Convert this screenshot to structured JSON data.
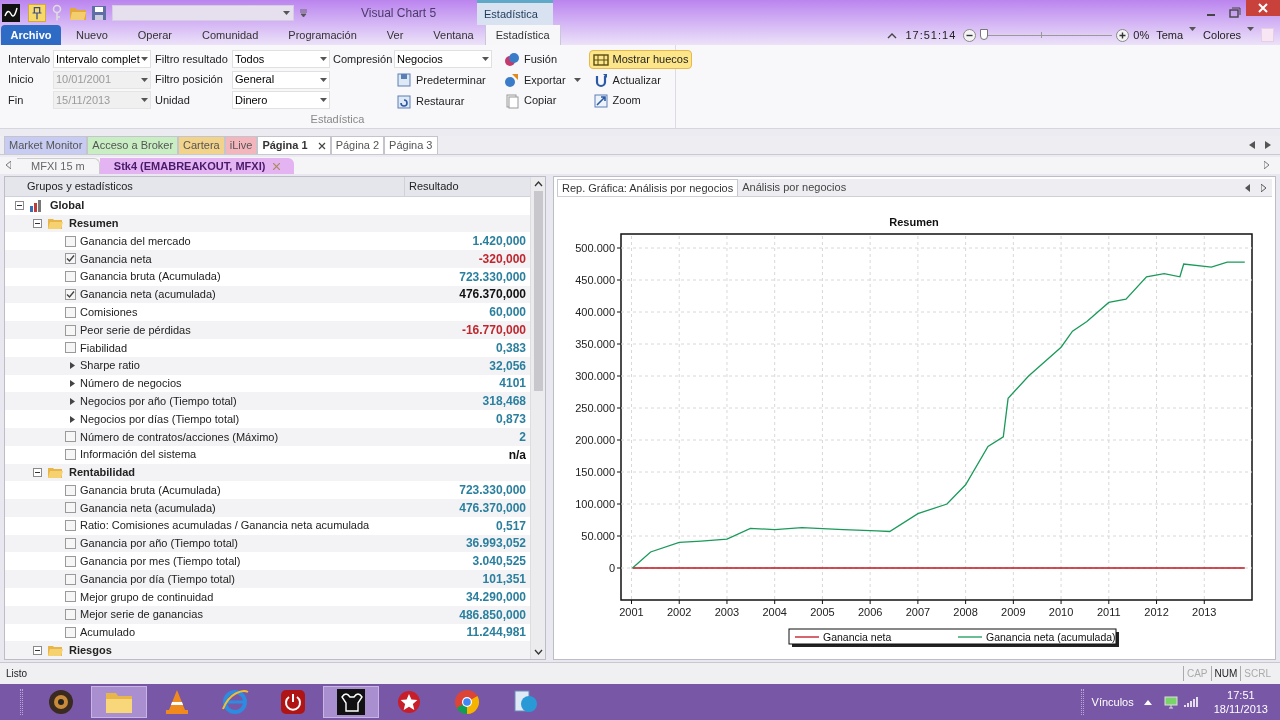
{
  "window": {
    "title": "Visual Chart 5",
    "contextual_tab": "Estadística"
  },
  "ribbon_tabs": [
    {
      "label": "Archivo",
      "kind": "file",
      "selected": false
    },
    {
      "label": "Nuevo",
      "kind": "tab",
      "selected": false
    },
    {
      "label": "Operar",
      "kind": "tab",
      "selected": false
    },
    {
      "label": "Comunidad",
      "kind": "tab",
      "selected": false
    },
    {
      "label": "Programación",
      "kind": "tab",
      "selected": false
    },
    {
      "label": "Ver",
      "kind": "tab",
      "selected": false
    },
    {
      "label": "Ventana",
      "kind": "tab",
      "selected": false
    },
    {
      "label": "Estadística",
      "kind": "tab",
      "selected": true
    }
  ],
  "clock": "17:51:14",
  "zoom": {
    "level": 0,
    "reading": "0%"
  },
  "theme_menus": [
    "Tema",
    "Colores"
  ],
  "ribbon": {
    "group": "Estadística",
    "fields": [
      {
        "label": "Intervalo",
        "value": "Intervalo complet",
        "disabled": false
      },
      {
        "label": "Inicio",
        "value": "10/01/2001",
        "disabled": true
      },
      {
        "label": "Fin",
        "value": "15/11/2013",
        "disabled": true
      },
      {
        "label": "Filtro resultado",
        "value": "Todos",
        "disabled": false
      },
      {
        "label": "Filtro posición",
        "value": "General",
        "disabled": false
      },
      {
        "label": "Unidad",
        "value": "Dinero",
        "disabled": false
      },
      {
        "label": "Compresión",
        "value": "Negocios",
        "disabled": false
      }
    ],
    "buttons": [
      {
        "label": "Predeterminar",
        "kind": "button"
      },
      {
        "label": "Restaurar",
        "kind": "button"
      },
      {
        "label": "Fusión",
        "kind": "button"
      },
      {
        "label": "Exportar",
        "kind": "menu"
      },
      {
        "label": "Copiar",
        "kind": "button"
      },
      {
        "label": "Mostrar huecos",
        "kind": "toggle",
        "on": true
      },
      {
        "label": "Actualizar",
        "kind": "button"
      },
      {
        "label": "Zoom",
        "kind": "button"
      }
    ]
  },
  "page_tabs": [
    {
      "label": "Market Monitor",
      "color": "#c9ccf2",
      "selected": false,
      "closable": false
    },
    {
      "label": "Acceso a Broker",
      "color": "#c9eec4",
      "selected": false,
      "closable": false
    },
    {
      "label": "Cartera",
      "color": "#f2d38c",
      "selected": false,
      "closable": false
    },
    {
      "label": "iLive",
      "color": "#f4b6bd",
      "selected": false,
      "closable": false
    },
    {
      "label": "Página 1",
      "color": "#ffffff",
      "selected": true,
      "closable": true
    },
    {
      "label": "Página 2",
      "color": "#ffffff",
      "selected": false,
      "closable": false
    },
    {
      "label": "Página 3",
      "color": "#ffffff",
      "selected": false,
      "closable": false
    }
  ],
  "doc_tabs": [
    {
      "label": "MFXI 15 m",
      "selected": false
    },
    {
      "label": "Stk4 (EMABREAKOUT, MFXI)",
      "selected": true
    }
  ],
  "tree": {
    "columns": [
      "Grupos y estadísticos",
      "Resultado"
    ],
    "nodes": [
      {
        "label": "Global",
        "kind": "root",
        "expanded": true,
        "children": [
          {
            "label": "Resumen",
            "kind": "folder",
            "expanded": true,
            "children": [
              {
                "label": "Ganancia del mercado",
                "kind": "check",
                "checked": false,
                "value": "1.420,000",
                "color": "#2a7f9e"
              },
              {
                "label": "Ganancia neta",
                "kind": "check",
                "checked": true,
                "value": "-320,000",
                "color": "#c0262d"
              },
              {
                "label": "Ganancia bruta (Acumulada)",
                "kind": "check",
                "checked": false,
                "value": "723.330,000",
                "color": "#2a7f9e"
              },
              {
                "label": "Ganancia neta (acumulada)",
                "kind": "check",
                "checked": true,
                "value": "476.370,000",
                "color": "#111111"
              },
              {
                "label": "Comisiones",
                "kind": "check",
                "checked": false,
                "value": "60,000",
                "color": "#2a7f9e"
              },
              {
                "label": "Peor serie de pérdidas",
                "kind": "check",
                "checked": false,
                "value": "-16.770,000",
                "color": "#c0262d"
              },
              {
                "label": "Fiabilidad",
                "kind": "check",
                "checked": false,
                "value": "0,383",
                "color": "#2a7f9e"
              },
              {
                "label": "Sharpe ratio",
                "kind": "stat",
                "expanded": false,
                "value": "32,056",
                "color": "#2a7f9e"
              },
              {
                "label": "Número de negocios",
                "kind": "stat",
                "expanded": false,
                "value": "4101",
                "color": "#2a7f9e"
              },
              {
                "label": "Negocios por año (Tiempo total)",
                "kind": "stat",
                "expanded": false,
                "value": "318,468",
                "color": "#2a7f9e"
              },
              {
                "label": "Negocios por días (Tiempo total)",
                "kind": "stat",
                "expanded": false,
                "value": "0,873",
                "color": "#2a7f9e"
              },
              {
                "label": "Número de contratos/acciones (Máximo)",
                "kind": "check",
                "checked": false,
                "value": "2",
                "color": "#2a7f9e"
              },
              {
                "label": "Información del sistema",
                "kind": "check",
                "checked": false,
                "value": "n/a",
                "color": "#111111"
              }
            ]
          },
          {
            "label": "Rentabilidad",
            "kind": "folder",
            "expanded": true,
            "children": [
              {
                "label": "Ganancia bruta (Acumulada)",
                "kind": "check",
                "checked": false,
                "value": "723.330,000",
                "color": "#2a7f9e"
              },
              {
                "label": "Ganancia neta (acumulada)",
                "kind": "check",
                "checked": false,
                "value": "476.370,000",
                "color": "#2a7f9e"
              },
              {
                "label": "Ratio: Comisiones acumuladas / Ganancia neta acumulada",
                "kind": "check",
                "checked": false,
                "value": "0,517",
                "color": "#2a7f9e"
              },
              {
                "label": "Ganancia por año (Tiempo total)",
                "kind": "check",
                "checked": false,
                "value": "36.993,052",
                "color": "#2a7f9e"
              },
              {
                "label": "Ganancia por mes (Tiempo total)",
                "kind": "check",
                "checked": false,
                "value": "3.040,525",
                "color": "#2a7f9e"
              },
              {
                "label": "Ganancia por día (Tiempo total)",
                "kind": "check",
                "checked": false,
                "value": "101,351",
                "color": "#2a7f9e"
              },
              {
                "label": "Mejor grupo de continuidad",
                "kind": "check",
                "checked": false,
                "value": "34.290,000",
                "color": "#2a7f9e"
              },
              {
                "label": "Mejor serie de ganancias",
                "kind": "check",
                "checked": false,
                "value": "486.850,000",
                "color": "#2a7f9e"
              },
              {
                "label": "Acumulado",
                "kind": "check",
                "checked": false,
                "value": "11.244,981",
                "color": "#2a7f9e"
              }
            ]
          },
          {
            "label": "Riesgos",
            "kind": "folder",
            "expanded": true
          }
        ]
      }
    ]
  },
  "chart_panel": {
    "tabs": [
      {
        "label": "Rep. Gráfica: Análisis por negocios",
        "selected": true
      },
      {
        "label": "Análisis por negocios",
        "selected": false
      }
    ],
    "chart_data": {
      "type": "line",
      "title": "Resumen",
      "x": [
        2001.02,
        2001.4,
        2002.0,
        2002.46,
        2003.0,
        2003.49,
        2004.0,
        2004.57,
        2005.44,
        2006.14,
        2006.41,
        2007.0,
        2007.61,
        2008.0,
        2008.47,
        2008.79,
        2008.89,
        2009.32,
        2010.0,
        2010.24,
        2010.54,
        2011.0,
        2011.36,
        2011.79,
        2012.16,
        2012.49,
        2012.57,
        2013.15,
        2013.48,
        2013.85
      ],
      "series": [
        {
          "name": "Ganancia neta",
          "color": "#c0141e",
          "values": [
            0,
            0,
            0,
            0,
            0,
            0,
            0,
            0,
            0,
            0,
            0,
            0,
            0,
            0,
            0,
            0,
            0,
            0,
            0,
            0,
            0,
            0,
            0,
            0,
            0,
            0,
            0,
            0,
            0,
            0
          ]
        },
        {
          "name": "Ganancia neta (acumulada)",
          "color": "#1a9a5a",
          "values": [
            0,
            25000,
            40000,
            42000,
            45000,
            62000,
            60000,
            63000,
            60000,
            58000,
            57000,
            85000,
            100000,
            130000,
            190000,
            205000,
            265000,
            300000,
            345000,
            370000,
            385000,
            415000,
            420000,
            455000,
            460000,
            455000,
            475000,
            470000,
            478000,
            478000
          ]
        }
      ],
      "grid": true,
      "legend": "bottom",
      "xlim": [
        2000.78,
        2014.0
      ],
      "ylim": [
        -50000,
        518750
      ],
      "xticks": [
        2001,
        2002,
        2003,
        2004,
        2005,
        2006,
        2007,
        2008,
        2009,
        2010,
        2011,
        2012,
        2013
      ],
      "yticks": [
        {
          "value": 0,
          "label": "0"
        },
        {
          "value": 50000,
          "label": "50.000"
        },
        {
          "value": 100000,
          "label": "100.000"
        },
        {
          "value": 150000,
          "label": "150.000"
        },
        {
          "value": 200000,
          "label": "200.000"
        },
        {
          "value": 250000,
          "label": "250.000"
        },
        {
          "value": 300000,
          "label": "300.000"
        },
        {
          "value": 350000,
          "label": "350.000"
        },
        {
          "value": 400000,
          "label": "400.000"
        },
        {
          "value": 450000,
          "label": "450.000"
        },
        {
          "value": 500000,
          "label": "500.000"
        }
      ]
    }
  },
  "status_bar": {
    "text": "Listo",
    "indicators": [
      {
        "label": "CAP",
        "on": false
      },
      {
        "label": "NUM",
        "on": true
      },
      {
        "label": "SCRL",
        "on": false
      }
    ]
  },
  "taskbar": {
    "apps": [
      {
        "active": false
      },
      {
        "active": true
      },
      {
        "active": false
      },
      {
        "active": false
      },
      {
        "active": false
      },
      {
        "active": true
      },
      {
        "active": false
      },
      {
        "active": false
      },
      {
        "active": false
      }
    ],
    "toolbar": "Vínculos",
    "time": "17:51",
    "date": "18/11/2013"
  }
}
